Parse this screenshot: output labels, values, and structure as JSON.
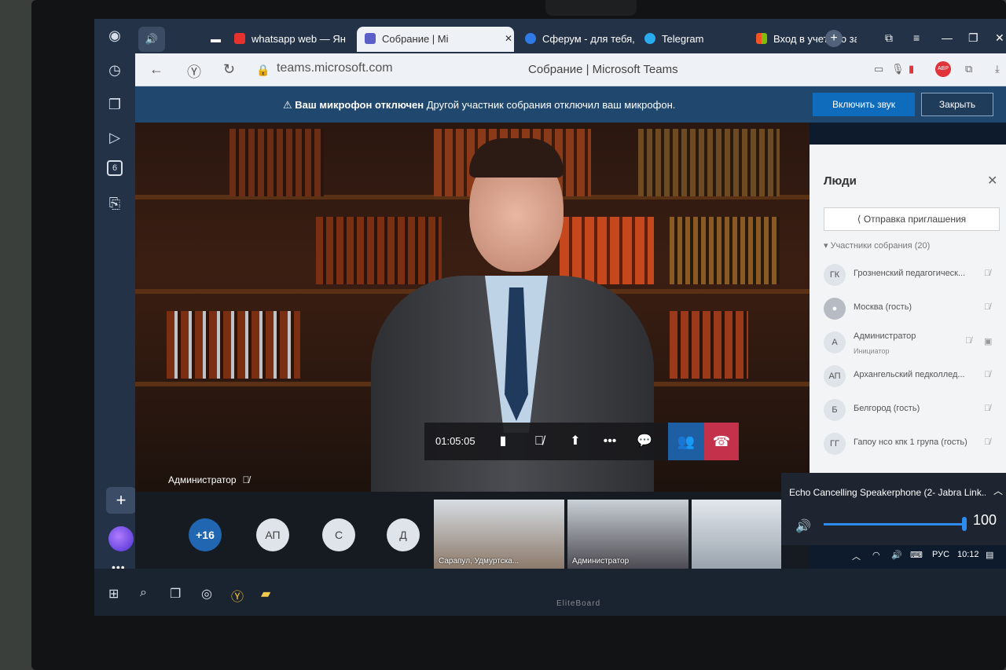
{
  "device": {
    "brand": "EliteBoard"
  },
  "sidebar": {
    "badge_count": "6",
    "more_label": "•••"
  },
  "tabs": [
    {
      "label": "whatsapp web — Ян",
      "color": "#e5322d"
    },
    {
      "label": "Собрание | Mi",
      "color": "#5b5fc7"
    },
    {
      "label": "Сферум - для тебя, ",
      "color": "#2e7be6"
    },
    {
      "label": "Telegram",
      "color": "#2aabee"
    },
    {
      "label": "Вход в учетную зап",
      "color": "#f35325"
    }
  ],
  "address_bar": {
    "url": "teams.microsoft.com",
    "page_title": "Собрание | Microsoft Teams",
    "adblock": "ABP"
  },
  "banner": {
    "title": "Ваш микрофон отключен",
    "message": "Другой участник собрания отключил ваш микрофон.",
    "unmute_label": "Включить звук",
    "close_label": "Закрыть"
  },
  "stage": {
    "speaker_name": "Администратор"
  },
  "controls": {
    "timer": "01:05:05"
  },
  "people": {
    "title": "Люди",
    "invite_label": "Отправка приглашения",
    "participants_header": "Участники собрания (20)",
    "participants": [
      {
        "initials": "ГК",
        "name": "Грозненский педагогическ...",
        "role": ""
      },
      {
        "initials": "",
        "name": "Москва (гость)",
        "role": ""
      },
      {
        "initials": "А",
        "name": "Администратор",
        "role": "Инициатор"
      },
      {
        "initials": "АП",
        "name": "Архангельский педколлед...",
        "role": ""
      },
      {
        "initials": "Б",
        "name": "Белгород (гость)",
        "role": ""
      },
      {
        "initials": "ГГ",
        "name": "Гапоу нсо кпк 1 група (гость)",
        "role": ""
      }
    ]
  },
  "gallery": {
    "more_count": "+16",
    "avatars": [
      "АП",
      "С",
      "Д"
    ],
    "thumbnails": [
      {
        "label": "Сарапул, Удмуртска..."
      },
      {
        "label": "Администратор"
      },
      {
        "label": ""
      }
    ]
  },
  "audio": {
    "device": "Echo Cancelling Speakerphone (2- Jabra Link...",
    "volume": 100,
    "volume_label": "100"
  },
  "taskbar": {
    "language": "РУС",
    "time": "10:12"
  }
}
